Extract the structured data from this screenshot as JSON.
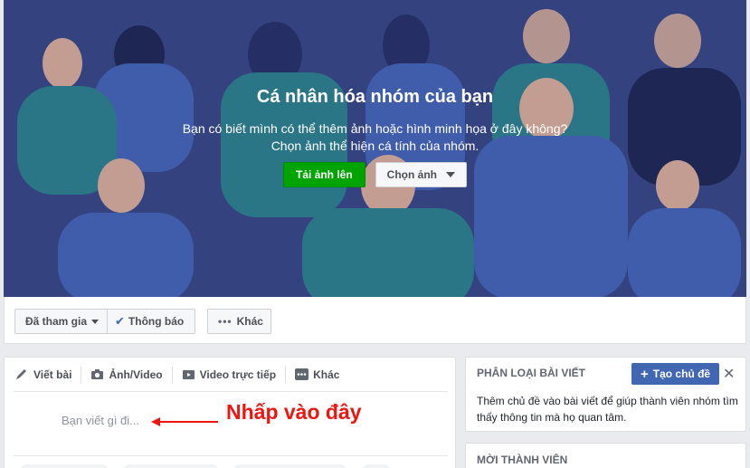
{
  "cover": {
    "title": "Cá nhân hóa nhóm của bạn",
    "desc_line1": "Bạn có biết mình có thể thêm ảnh hoặc hình minh họa ở đây không?",
    "desc_line2": "Chọn ảnh thể hiện cá tính của nhóm.",
    "upload_label": "Tải ảnh lên",
    "choose_label": "Chọn ảnh"
  },
  "actionbar": {
    "joined_label": "Đã tham gia",
    "notify_label": "Thông báo",
    "more_label": "Khác"
  },
  "composer": {
    "tabs": [
      {
        "label": "Viết bài",
        "icon": "pencil-icon"
      },
      {
        "label": "Ảnh/Video",
        "icon": "camera-icon"
      },
      {
        "label": "Video trực tiếp",
        "icon": "video-camera-icon"
      },
      {
        "label": "Khác",
        "icon": "more-icon"
      }
    ],
    "placeholder": "Bạn viết gì đi...",
    "annotation": "Nhấp vào đây"
  },
  "topics": {
    "heading": "PHÂN LOẠI BÀI VIẾT",
    "create_label": "Tạo chủ đề",
    "desc": "Thêm chủ đề vào bài viết để giúp thành viên nhóm tìm thấy thông tin mà họ quan tâm."
  },
  "invite": {
    "heading": "MỜI THÀNH VIÊN"
  },
  "colors": {
    "cover_bg": "#3b4d92",
    "upload_green": "#00a400",
    "brand_blue": "#4267b2",
    "annotation_red": "#f0140f"
  }
}
